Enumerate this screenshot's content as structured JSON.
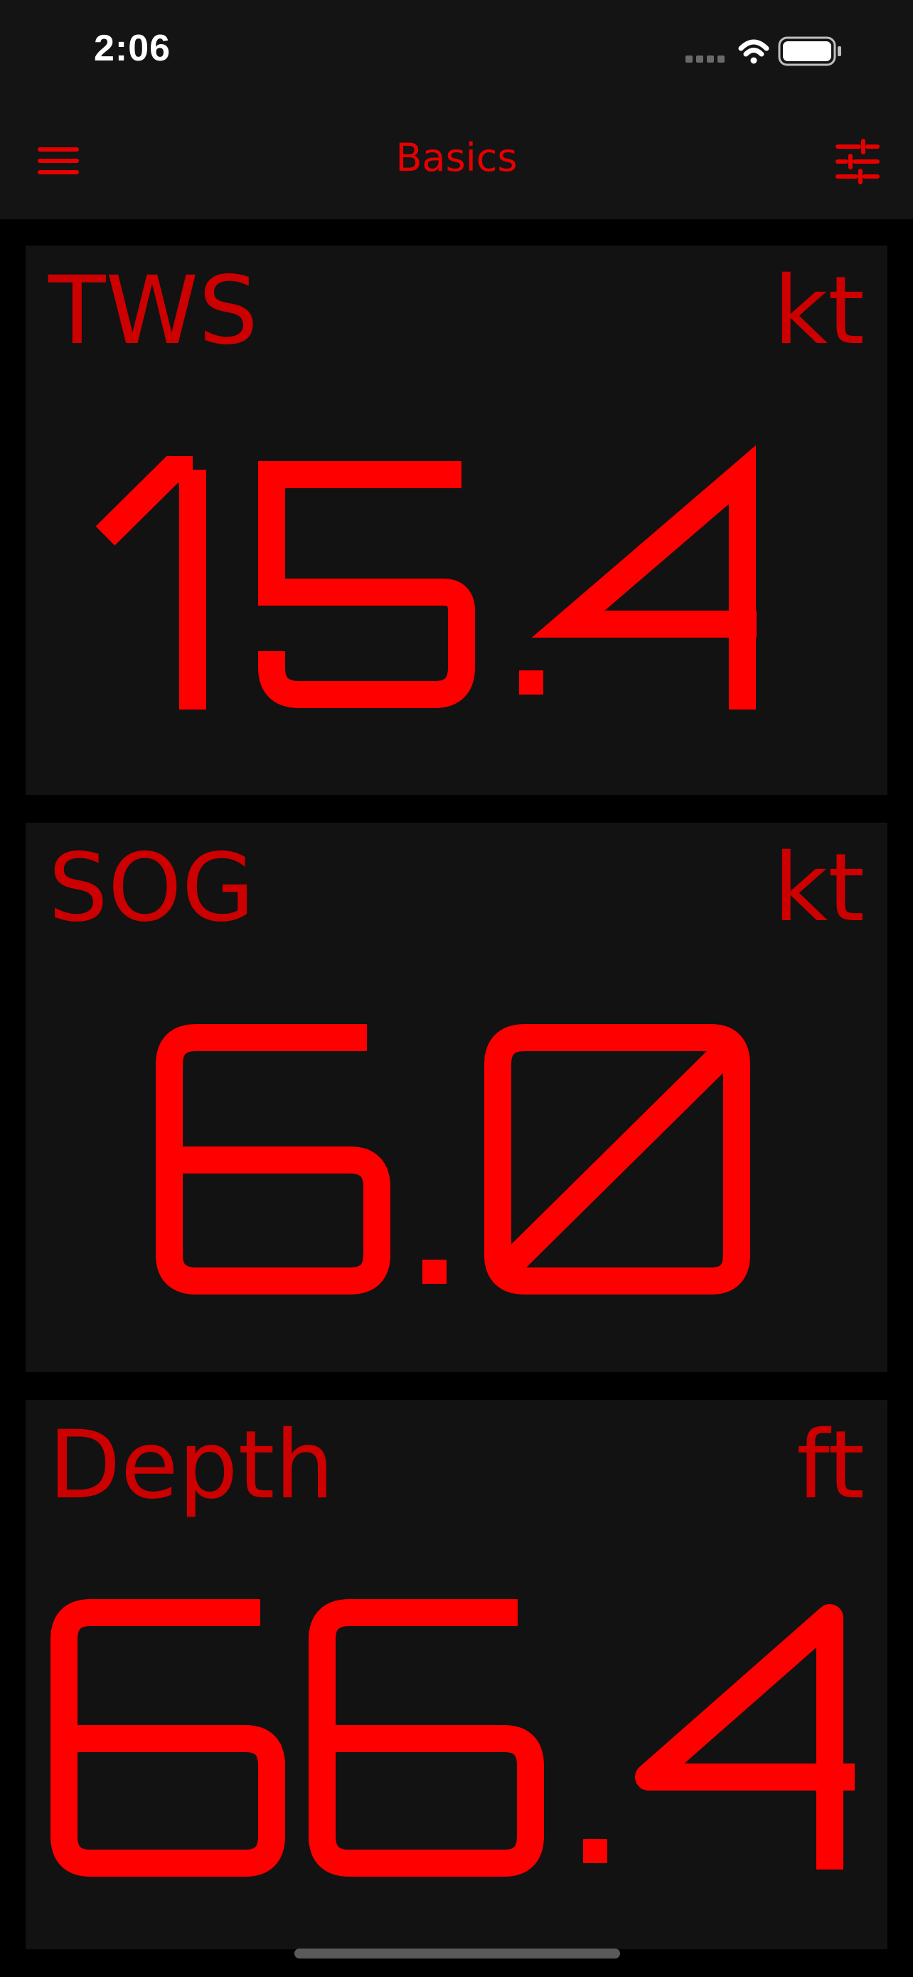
{
  "status_bar": {
    "time": "2:06",
    "icons": [
      "cellular-icon",
      "wifi-icon",
      "battery-icon"
    ]
  },
  "nav": {
    "title": "Basics",
    "left_icon": "hamburger-menu-icon",
    "right_icon": "sliders-icon"
  },
  "colors": {
    "background": "#000000",
    "panel": "#121212",
    "bar": "#141414",
    "accent": "#e60000",
    "label": "#cc0000",
    "value": "#ff0000"
  },
  "tiles": [
    {
      "label": "TWS",
      "unit": "kt",
      "value": "15.4"
    },
    {
      "label": "SOG",
      "unit": "kt",
      "value": "6.0"
    },
    {
      "label": "Depth",
      "unit": "ft",
      "value": "66.4"
    }
  ]
}
